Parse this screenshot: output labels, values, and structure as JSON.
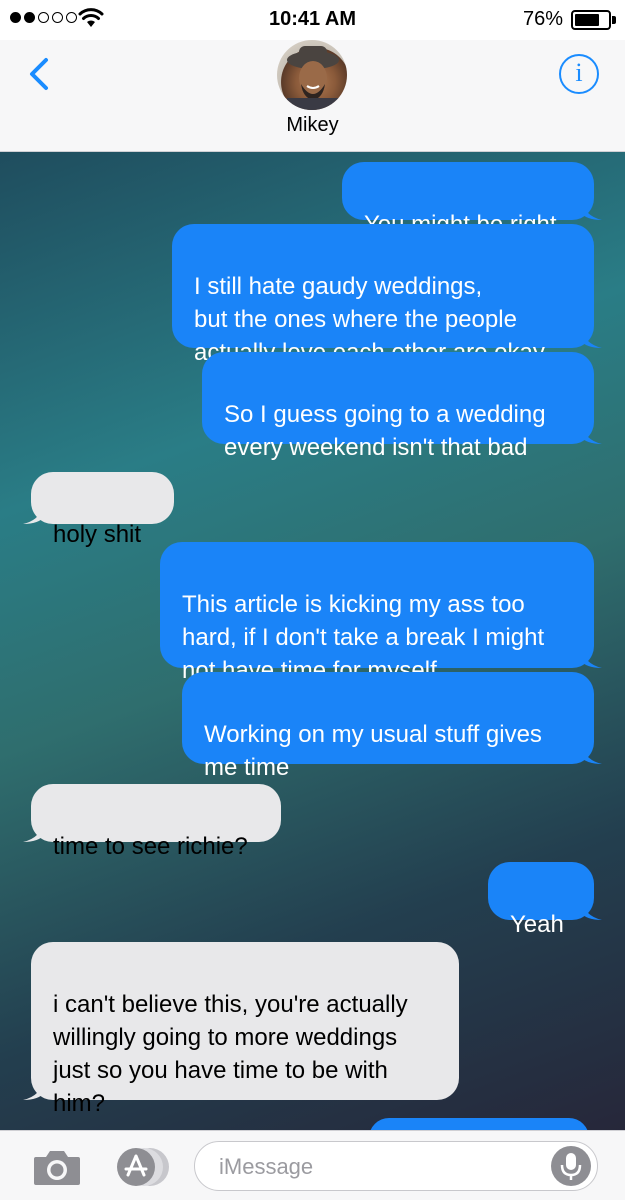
{
  "status_bar": {
    "time": "10:41 AM",
    "battery_percent": "76%",
    "battery_level": 0.76,
    "signal_bars_filled": 2,
    "signal_bars_total": 5
  },
  "header": {
    "contact_name": "Mikey",
    "back_icon": "chevron-left-icon",
    "info_icon": "info-icon",
    "info_glyph": "i"
  },
  "messages": [
    {
      "direction": "outgoing",
      "text": "You might be right"
    },
    {
      "direction": "outgoing",
      "text": "I still hate gaudy weddings,\nbut the ones where the people\nactually love each other are okay"
    },
    {
      "direction": "outgoing",
      "text": "So I guess going to a wedding\nevery weekend isn't that bad"
    },
    {
      "direction": "incoming",
      "text": "holy shit"
    },
    {
      "direction": "outgoing",
      "text": "This article is kicking my ass too\nhard, if I don't take a break I might\nnot have time for myself"
    },
    {
      "direction": "outgoing",
      "text": "Working on my usual stuff gives\nme time"
    },
    {
      "direction": "incoming",
      "text": "time to see richie?"
    },
    {
      "direction": "outgoing",
      "text": "Yeah"
    },
    {
      "direction": "incoming",
      "text": "i can't believe this, you're actually\nwillingly going to more weddings\njust so you have time to be with\nhim?"
    },
    {
      "direction": "outgoing",
      "text": ""
    }
  ],
  "input_bar": {
    "placeholder": "iMessage",
    "camera_icon": "camera-icon",
    "apps_icon": "app-store-icon",
    "mic_icon": "microphone-icon"
  },
  "colors": {
    "accent": "#1a8cff",
    "outgoing_bubble": "#1a84f8",
    "incoming_bubble": "#e8e8ea"
  }
}
